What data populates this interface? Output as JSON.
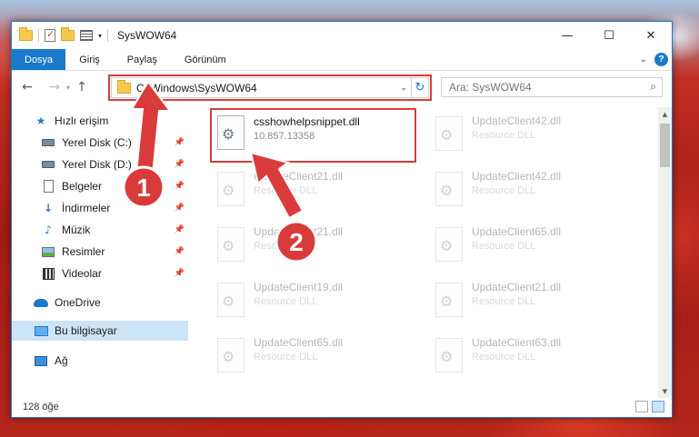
{
  "window": {
    "title": "SysWOW64",
    "controls": {
      "minimize": "—",
      "maximize": "☐",
      "close": "✕"
    }
  },
  "ribbon": {
    "tabs": [
      {
        "label": "Dosya",
        "active": true
      },
      {
        "label": "Giriş"
      },
      {
        "label": "Paylaş"
      },
      {
        "label": "Görünüm"
      }
    ],
    "help": "?"
  },
  "nav": {
    "back": "←",
    "forward": "→",
    "up": "↑",
    "address": "C:\\Windows\\SysWOW64",
    "search_placeholder": "Ara: SysWOW64"
  },
  "sidebar": {
    "items": [
      {
        "label": "Hızlı erişim",
        "icon": "star-icon"
      },
      {
        "label": "Yerel Disk (C:)",
        "icon": "disk-icon",
        "pinned": true
      },
      {
        "label": "Yerel Disk (D:)",
        "icon": "disk-icon",
        "pinned": true
      },
      {
        "label": "Belgeler",
        "icon": "document-icon",
        "pinned": true
      },
      {
        "label": "İndirmeler",
        "icon": "download-icon",
        "pinned": true
      },
      {
        "label": "Müzik",
        "icon": "music-icon",
        "pinned": true
      },
      {
        "label": "Resimler",
        "icon": "pictures-icon",
        "pinned": true
      },
      {
        "label": "Videolar",
        "icon": "videos-icon",
        "pinned": true
      },
      {
        "label": "OneDrive",
        "icon": "cloud-icon"
      },
      {
        "label": "Bu bilgisayar",
        "icon": "computer-icon",
        "selected": true
      },
      {
        "label": "Ağ",
        "icon": "network-icon"
      }
    ]
  },
  "files": {
    "left": [
      {
        "name": "csshowhelpsnippet.dll",
        "sub": "10.857.13358",
        "highlighted": true
      },
      {
        "name": "UpdateClient21.dll",
        "sub": "Resource DLL"
      },
      {
        "name": "UpdateClient21.dll",
        "sub": "Resource DLL"
      },
      {
        "name": "UpdateClient19.dll",
        "sub": "Resource DLL"
      },
      {
        "name": "UpdateClient65.dll",
        "sub": "Resource DLL"
      }
    ],
    "right": [
      {
        "name": "UpdateClient42.dll",
        "sub": "Resource DLL"
      },
      {
        "name": "UpdateClient42.dll",
        "sub": "Resource DLL"
      },
      {
        "name": "UpdateClient65.dll",
        "sub": "Resource DLL"
      },
      {
        "name": "UpdateClient21.dll",
        "sub": "Resource DLL"
      },
      {
        "name": "UpdateClient63.dll",
        "sub": "Resource DLL"
      }
    ]
  },
  "status": {
    "count": "128 öğe"
  },
  "annotations": {
    "step1": "1",
    "step2": "2",
    "color": "#d93b3b"
  }
}
